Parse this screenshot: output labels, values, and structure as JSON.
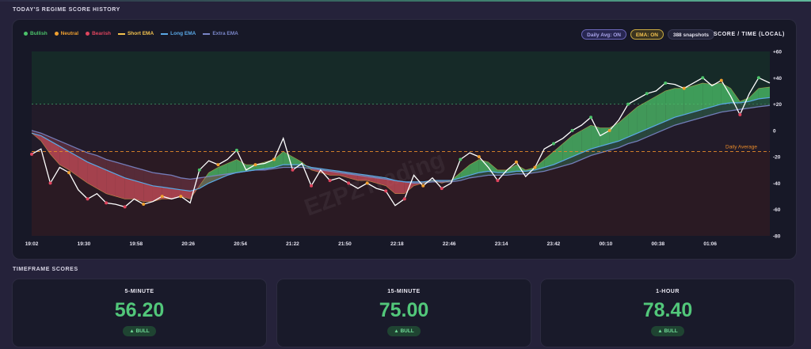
{
  "header": {
    "title": "TODAY'S REGIME SCORE HISTORY"
  },
  "legend": [
    {
      "label": "Bullish",
      "color": "#4cc36a",
      "kind": "dot"
    },
    {
      "label": "Neutral",
      "color": "#f0a030",
      "kind": "dot"
    },
    {
      "label": "Bearish",
      "color": "#e0455e",
      "kind": "dot"
    },
    {
      "label": "Short EMA",
      "color": "#f2c14e",
      "kind": "line"
    },
    {
      "label": "Long EMA",
      "color": "#5aa8e6",
      "kind": "line"
    },
    {
      "label": "Extra EMA",
      "color": "#7a86c8",
      "kind": "line"
    }
  ],
  "controls": {
    "daily_avg": "Daily Avg: ON",
    "ema": "EMA: ON",
    "snapshots": "388 snapshots",
    "axis_title": "SCORE / TIME (LOCAL)"
  },
  "chart_data": {
    "type": "line",
    "watermark": "EZPZTrading",
    "x_ticks": [
      "19:02",
      "19:30",
      "19:58",
      "20:26",
      "20:54",
      "21:22",
      "21:50",
      "22:18",
      "22:46",
      "23:14",
      "23:42",
      "00:10",
      "00:38",
      "01:06"
    ],
    "y_ticks": [
      "+60",
      "+40",
      "+20",
      "0",
      "-20",
      "-40",
      "-60",
      "-80"
    ],
    "ylim": [
      -80,
      60
    ],
    "x_range_minutes": [
      0,
      396
    ],
    "daily_average": {
      "label": "Daily Average",
      "value": -16
    },
    "grid": false,
    "series": [
      {
        "key": "score",
        "color": "#ffffff",
        "x": [
          0,
          5,
          10,
          15,
          20,
          25,
          30,
          35,
          40,
          45,
          50,
          55,
          60,
          65,
          70,
          75,
          80,
          85,
          90,
          95,
          100,
          105,
          110,
          115,
          120,
          125,
          130,
          135,
          140,
          145,
          150,
          155,
          160,
          165,
          170,
          175,
          180,
          185,
          190,
          195,
          200,
          205,
          210,
          215,
          220,
          225,
          230,
          235,
          240,
          245,
          250,
          255,
          260,
          265,
          270,
          275,
          280,
          285,
          290,
          295,
          300,
          305,
          310,
          315,
          320,
          325,
          330,
          335,
          340,
          345,
          350,
          355,
          360,
          365,
          370,
          375,
          380,
          385,
          390,
          396
        ],
        "values": [
          -18,
          -14,
          -40,
          -28,
          -32,
          -45,
          -52,
          -48,
          -55,
          -56,
          -58,
          -52,
          -56,
          -54,
          -50,
          -52,
          -50,
          -55,
          -30,
          -23,
          -26,
          -22,
          -15,
          -30,
          -26,
          -25,
          -22,
          -6,
          -30,
          -25,
          -42,
          -30,
          -38,
          -36,
          -40,
          -44,
          -40,
          -44,
          -46,
          -57,
          -52,
          -34,
          -42,
          -36,
          -44,
          -40,
          -22,
          -17,
          -20,
          -28,
          -38,
          -30,
          -24,
          -35,
          -28,
          -14,
          -10,
          -6,
          0,
          4,
          10,
          -4,
          0,
          8,
          20,
          24,
          28,
          30,
          36,
          35,
          32,
          36,
          40,
          34,
          38,
          26,
          12,
          28,
          40,
          36
        ]
      },
      {
        "key": "short_ema",
        "color": "#f2c14e",
        "values": [
          -2,
          -8,
          -18,
          -26,
          -30,
          -35,
          -40,
          -44,
          -48,
          -50,
          -52,
          -52,
          -54,
          -54,
          -52,
          -52,
          -50,
          -52,
          -42,
          -32,
          -28,
          -25,
          -22,
          -26,
          -26,
          -24,
          -22,
          -16,
          -20,
          -24,
          -30,
          -32,
          -34,
          -34,
          -36,
          -38,
          -38,
          -40,
          -42,
          -48,
          -48,
          -42,
          -40,
          -38,
          -40,
          -38,
          -32,
          -26,
          -22,
          -24,
          -30,
          -30,
          -26,
          -30,
          -28,
          -22,
          -16,
          -10,
          -4,
          0,
          4,
          2,
          2,
          6,
          12,
          18,
          22,
          26,
          30,
          32,
          32,
          34,
          36,
          35,
          36,
          32,
          22,
          25,
          32,
          33
        ]
      },
      {
        "key": "long_ema",
        "color": "#5aa8e6",
        "values": [
          -2,
          -4,
          -8,
          -12,
          -16,
          -20,
          -24,
          -27,
          -30,
          -33,
          -36,
          -38,
          -40,
          -42,
          -43,
          -44,
          -45,
          -46,
          -44,
          -40,
          -37,
          -34,
          -32,
          -31,
          -30,
          -29,
          -28,
          -26,
          -26,
          -26,
          -28,
          -29,
          -30,
          -31,
          -32,
          -33,
          -34,
          -35,
          -36,
          -38,
          -39,
          -39,
          -39,
          -38,
          -38,
          -38,
          -36,
          -34,
          -32,
          -31,
          -32,
          -32,
          -31,
          -31,
          -30,
          -28,
          -26,
          -23,
          -20,
          -17,
          -14,
          -12,
          -10,
          -8,
          -5,
          -2,
          1,
          4,
          7,
          10,
          12,
          14,
          16,
          18,
          20,
          21,
          21,
          22,
          24,
          25
        ]
      },
      {
        "key": "extra_ema",
        "color": "#7a86c8",
        "values": [
          0,
          -2,
          -5,
          -8,
          -11,
          -14,
          -17,
          -19,
          -22,
          -24,
          -26,
          -28,
          -30,
          -32,
          -33,
          -34,
          -36,
          -37,
          -36,
          -35,
          -34,
          -33,
          -32,
          -31,
          -30,
          -30,
          -29,
          -28,
          -28,
          -28,
          -29,
          -30,
          -31,
          -32,
          -33,
          -34,
          -35,
          -36,
          -37,
          -38,
          -39,
          -40,
          -40,
          -39,
          -39,
          -39,
          -38,
          -36,
          -35,
          -34,
          -34,
          -34,
          -33,
          -33,
          -32,
          -31,
          -29,
          -27,
          -25,
          -22,
          -19,
          -17,
          -15,
          -13,
          -10,
          -8,
          -5,
          -2,
          1,
          4,
          6,
          8,
          10,
          12,
          14,
          15,
          16,
          17,
          18,
          19
        ]
      }
    ],
    "regime_markers": "colored dots on score line: green=bullish, orange=neutral, red=bearish"
  },
  "timeframes_title": "TIMEFRAME SCORES",
  "timeframes": [
    {
      "label": "5-MINUTE",
      "value": "56.20",
      "badge": "▲ BULL"
    },
    {
      "label": "15-MINUTE",
      "value": "75.00",
      "badge": "▲ BULL"
    },
    {
      "label": "1-HOUR",
      "value": "78.40",
      "badge": "▲ BULL"
    }
  ]
}
